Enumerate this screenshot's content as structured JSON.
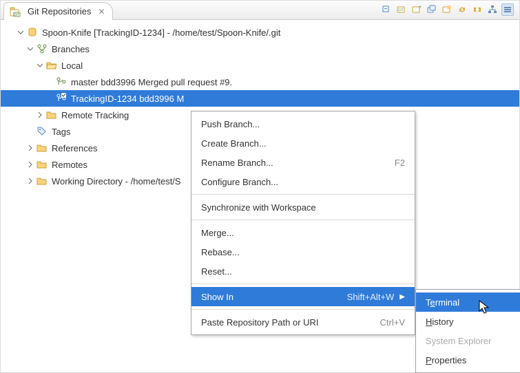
{
  "tab": {
    "title": "Git Repositories"
  },
  "tree": {
    "repo": "Spoon-Knife [TrackingID-1234] - /home/test/Spoon-Knife/.git",
    "branches": "Branches",
    "local": "Local",
    "master": "master bdd3996 Merged pull request #9.",
    "tracking_branch": "TrackingID-1234 bdd3996 M",
    "remote_tracking": "Remote Tracking",
    "tags": "Tags",
    "references": "References",
    "remotes": "Remotes",
    "working_dir": "Working Directory - /home/test/S"
  },
  "context_menu": {
    "push": "Push Branch...",
    "create": "Create Branch...",
    "rename": "Rename Branch...",
    "rename_key": "F2",
    "configure": "Configure Branch...",
    "sync": "Synchronize with Workspace",
    "merge": "Merge...",
    "rebase": "Rebase...",
    "reset": "Reset...",
    "showin": "Show In",
    "showin_key": "Shift+Alt+W",
    "paste": "Paste Repository Path or URI",
    "paste_key": "Ctrl+V"
  },
  "submenu": {
    "terminal_pre": "T",
    "terminal_mn": "e",
    "terminal_post": "rminal",
    "history_mn": "H",
    "history_post": "istory",
    "system_explorer": "System Explorer",
    "properties_mn": "P",
    "properties_post": "roperties"
  }
}
